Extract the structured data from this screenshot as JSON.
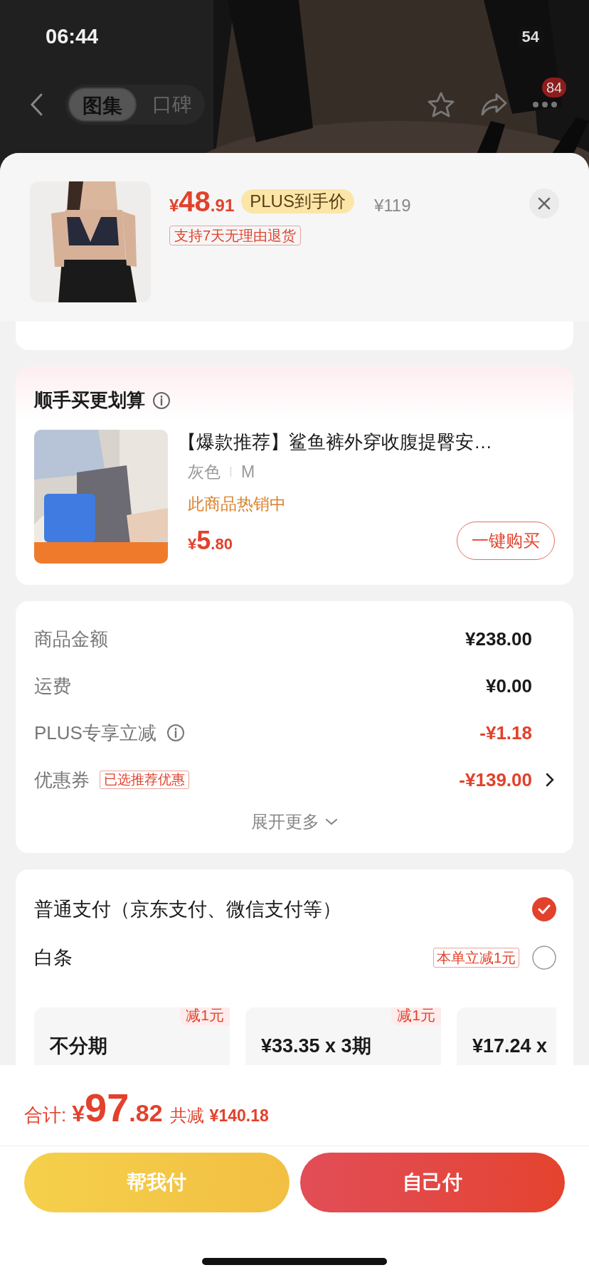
{
  "status_bar": {
    "time": "06:44",
    "battery": "54"
  },
  "nav": {
    "tabs": [
      {
        "label": "图集",
        "selected": true
      },
      {
        "label": "口碑",
        "selected": false
      }
    ],
    "badge": "84"
  },
  "product": {
    "price_symbol": "¥",
    "price_integer": "48",
    "price_decimal": ".91",
    "price_tag": "PLUS到手价",
    "original_price": "¥119",
    "return_policy": "支持7天无理由退货"
  },
  "bundle": {
    "title": "顺手买更划算",
    "item": {
      "title": "【爆款推荐】鲨鱼裤外穿收腹提臀安…",
      "variant": "灰色",
      "size": "M",
      "status": "此商品热销中",
      "price_symbol": "¥",
      "price_integer": "5",
      "price_decimal": ".80",
      "buy_button": "一键购买"
    }
  },
  "summary": {
    "rows": [
      {
        "label": "商品金额",
        "value": "¥238.00",
        "discount": false,
        "info": false,
        "link": false
      },
      {
        "label": "运费",
        "value": "¥0.00",
        "discount": false,
        "info": false,
        "link": false
      },
      {
        "label": "PLUS专享立减",
        "value": "-¥1.18",
        "discount": true,
        "info": true,
        "link": false
      },
      {
        "label": "优惠券",
        "tag": "已选推荐优惠",
        "value": "-¥139.00",
        "discount": true,
        "info": false,
        "link": true
      }
    ],
    "expand": "展开更多"
  },
  "payment": {
    "options": [
      {
        "label": "普通支付（京东支付、微信支付等）",
        "selected": true
      },
      {
        "label": "白条",
        "promo": "本单立减1元",
        "selected": false
      }
    ],
    "installments": [
      {
        "title": "不分期",
        "badge": "减1元"
      },
      {
        "title": "¥33.35 x 3期",
        "badge": "减1元"
      },
      {
        "title": "¥17.24 x"
      }
    ]
  },
  "footer": {
    "total_label": "合计:",
    "total_symbol": "¥",
    "total_integer": "97",
    "total_decimal": ".82",
    "saving_label": "共减",
    "saving_amount": "¥140.18",
    "buttons": [
      {
        "kind": "secondary",
        "label": "帮我付"
      },
      {
        "kind": "primary",
        "label": "自己付"
      }
    ]
  }
}
